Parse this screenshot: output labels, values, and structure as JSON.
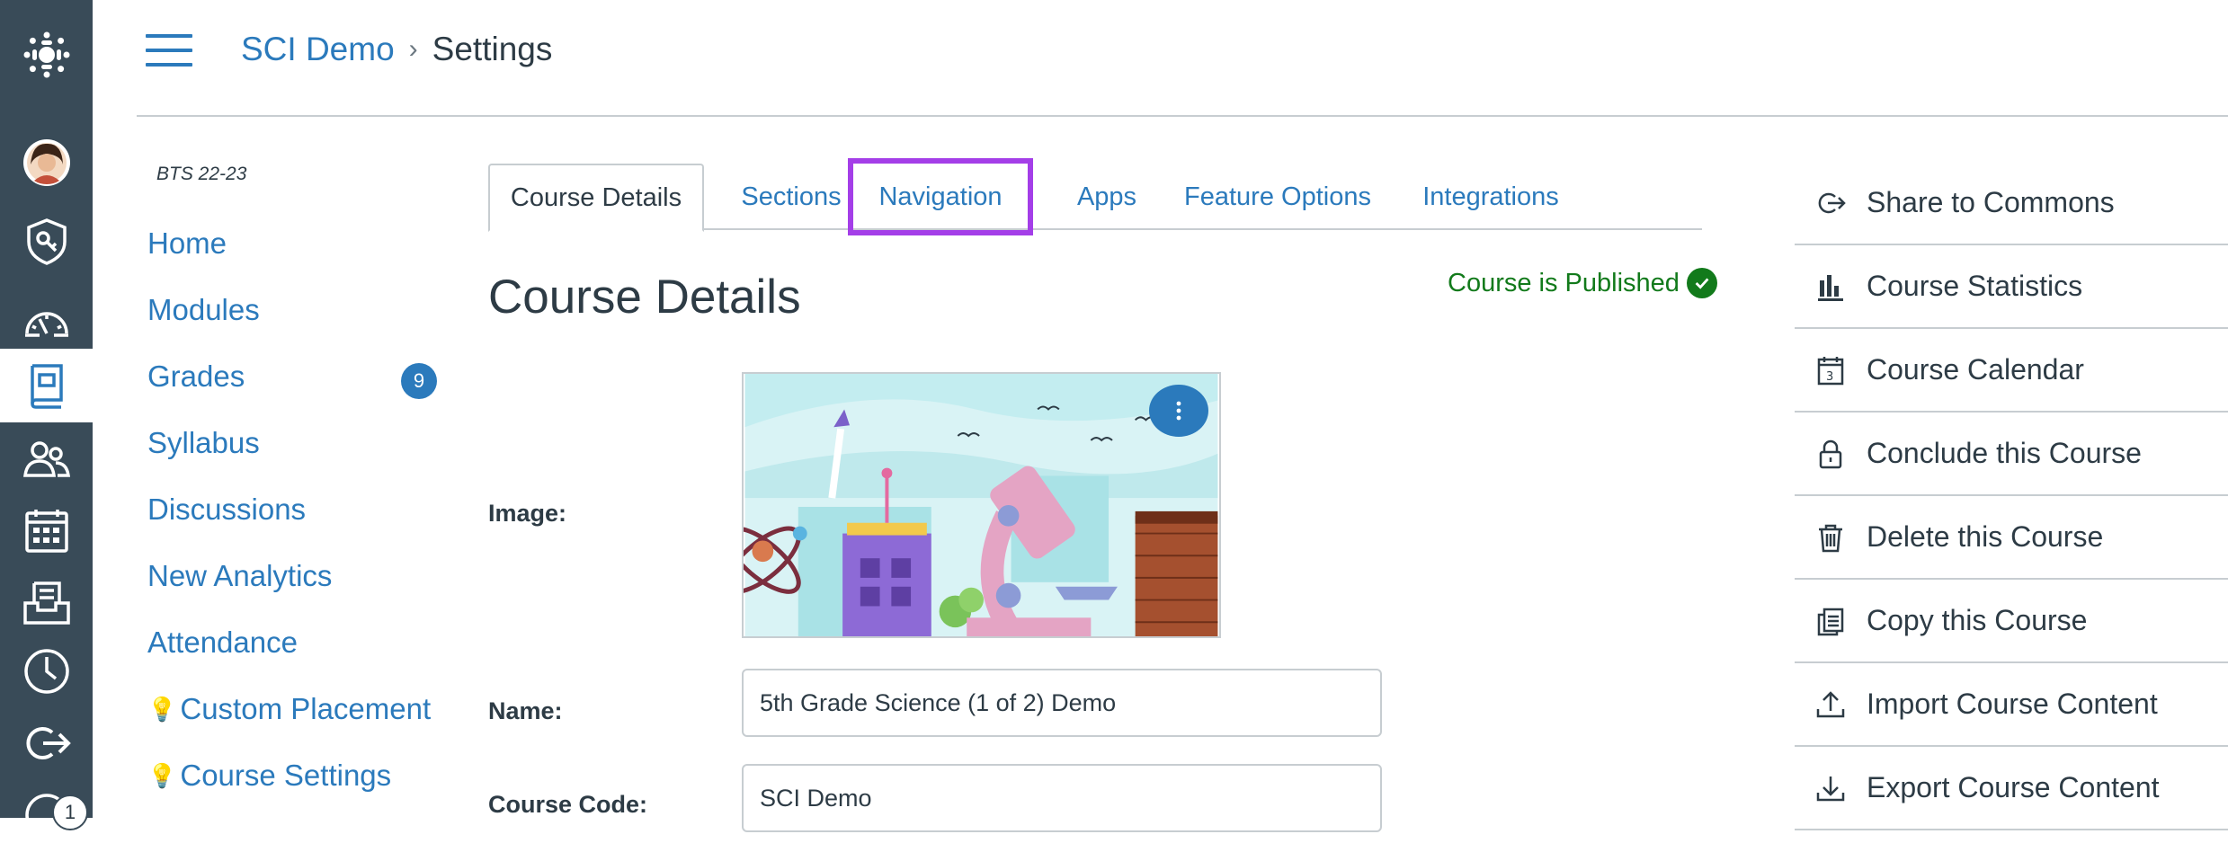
{
  "breadcrumb": {
    "course": "SCI Demo",
    "separator": "›",
    "current": "Settings"
  },
  "global_nav": {
    "items": [
      {
        "icon": "canvas-logo-icon"
      },
      {
        "icon": "avatar-icon"
      },
      {
        "icon": "admin-shield-icon"
      },
      {
        "icon": "dashboard-icon"
      },
      {
        "icon": "courses-icon",
        "active": true
      },
      {
        "icon": "groups-icon"
      },
      {
        "icon": "calendar-icon"
      },
      {
        "icon": "inbox-icon"
      },
      {
        "icon": "history-icon"
      },
      {
        "icon": "commons-icon"
      },
      {
        "icon": "help-icon"
      }
    ],
    "help_badge": "1"
  },
  "course_nav": {
    "term": "BTS 22-23",
    "items": [
      {
        "label": "Home"
      },
      {
        "label": "Modules"
      },
      {
        "label": "Grades",
        "badge": "9"
      },
      {
        "label": "Syllabus"
      },
      {
        "label": "Discussions"
      },
      {
        "label": "New Analytics"
      },
      {
        "label": "Attendance"
      },
      {
        "label": "Custom Placement",
        "bulb": true
      },
      {
        "label": "Course Settings",
        "bulb": true
      }
    ]
  },
  "tabs": [
    {
      "label": "Course Details",
      "active": true
    },
    {
      "label": "Sections"
    },
    {
      "label": "Navigation",
      "highlighted": true
    },
    {
      "label": "Apps"
    },
    {
      "label": "Feature Options"
    },
    {
      "label": "Integrations"
    }
  ],
  "main": {
    "title": "Course Details",
    "status": "Course is Published",
    "image_label": "Image:",
    "name_label": "Name:",
    "name_value": "5th Grade Science (1 of 2) Demo",
    "code_label": "Course Code:",
    "code_value": "SCI Demo"
  },
  "sidebar_actions": [
    {
      "label": "Share to Commons",
      "icon": "share-icon"
    },
    {
      "label": "Course Statistics",
      "icon": "bar-chart-icon"
    },
    {
      "label": "Course Calendar",
      "icon": "calendar-small-icon"
    },
    {
      "label": "Conclude this Course",
      "icon": "lock-icon"
    },
    {
      "label": "Delete this Course",
      "icon": "trash-icon"
    },
    {
      "label": "Copy this Course",
      "icon": "copy-icon"
    },
    {
      "label": "Import Course Content",
      "icon": "upload-icon"
    },
    {
      "label": "Export Course Content",
      "icon": "download-icon"
    }
  ],
  "colors": {
    "link": "#2b7abc",
    "nav_bg": "#394b58",
    "highlight": "#a43ee8",
    "success": "#127a1b"
  }
}
